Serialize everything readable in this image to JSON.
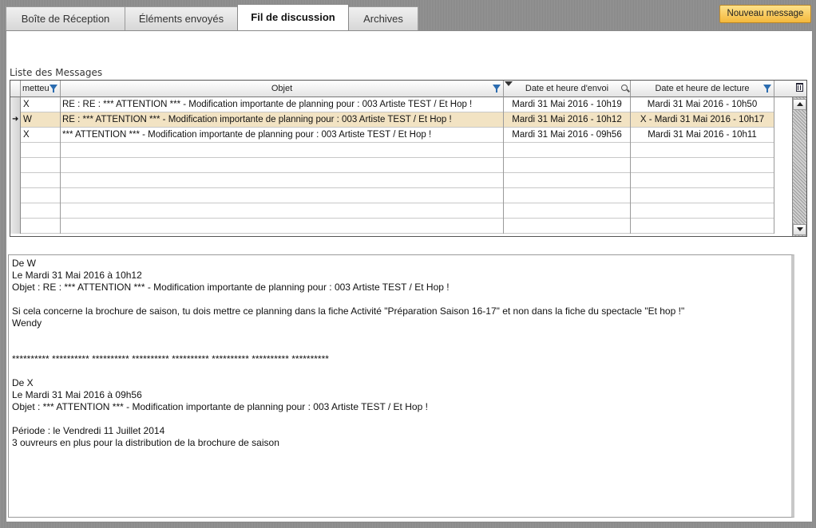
{
  "tabs": [
    {
      "label": "Boîte de Réception"
    },
    {
      "label": "Éléments envoyés"
    },
    {
      "label": "Fil de discussion"
    },
    {
      "label": "Archives"
    }
  ],
  "new_message_label": "Nouveau message",
  "list_title": "Liste des Messages",
  "columns": {
    "sender": "metteu",
    "subject": "Objet",
    "sent": "Date et heure d'envoi",
    "read": "Date et heure de lecture"
  },
  "rows": [
    {
      "sender": "X",
      "subject": "RE : RE : *** ATTENTION *** - Modification importante de planning pour : 003 Artiste TEST / Et Hop !",
      "sent": "Mardi 31 Mai 2016 - 10h19",
      "read": "Mardi 31 Mai 2016  -  10h50"
    },
    {
      "sender": "W",
      "subject": "RE : *** ATTENTION *** - Modification importante de planning pour : 003 Artiste TEST / Et Hop !",
      "sent": "Mardi 31 Mai 2016 - 10h12",
      "read": "X - Mardi 31 Mai 2016  -  10h17"
    },
    {
      "sender": "X",
      "subject": "*** ATTENTION *** - Modification importante de planning pour : 003 Artiste TEST / Et Hop !",
      "sent": "Mardi 31 Mai 2016 - 09h56",
      "read": "Mardi 31 Mai 2016  -  10h11"
    }
  ],
  "selected_row": 1,
  "message_lines": [
    "De W",
    "Le Mardi 31 Mai 2016 à 10h12",
    "Objet : RE : *** ATTENTION *** - Modification importante de planning pour : 003 Artiste TEST / Et Hop !",
    "",
    "Si cela concerne la brochure de saison, tu dois mettre ce planning dans la fiche Activité \"Préparation Saison 16-17\" et non dans la fiche du spectacle \"Et hop !\"",
    "Wendy",
    "",
    "",
    "********** ********** ********** ********** ********** ********** ********** **********",
    "",
    "De X",
    "Le Mardi 31 Mai 2016 à 09h56",
    "Objet : *** ATTENTION *** - Modification importante de planning pour : 003 Artiste TEST / Et Hop !",
    "",
    "Période : le Vendredi 11 Juillet 2014",
    "3 ouvreurs en plus pour la distribution de la brochure de saison"
  ],
  "colors": {
    "selected_row": "#f2e3c3",
    "new_message_button": "#f4b83c",
    "filter_icon": "#2b6cb0"
  }
}
